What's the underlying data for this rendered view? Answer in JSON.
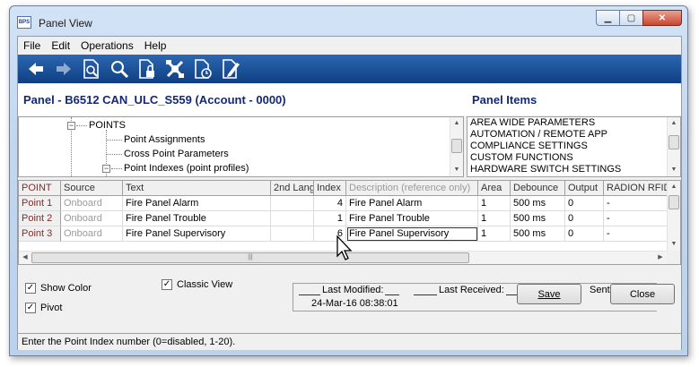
{
  "window": {
    "title": "Panel View",
    "icon_label": "BPS"
  },
  "menu": [
    "File",
    "Edit",
    "Operations",
    "Help"
  ],
  "toolbar": [
    "back-arrow-icon",
    "forward-arrow-icon",
    "print-preview-icon",
    "search-icon",
    "lock-document-icon",
    "network-icon",
    "document-clock-icon",
    "edit-document-icon"
  ],
  "header": {
    "panel_title": "Panel - B6512 CAN_ULC_S559 (Account - 0000)",
    "panel_items_title": "Panel Items"
  },
  "tree": {
    "points": "POINTS",
    "point_assignments": "Point Assignments",
    "cross_point_parameters": "Cross Point Parameters",
    "point_indexes": "Point Indexes (point profiles)"
  },
  "panel_items": [
    "AREA WIDE PARAMETERS",
    "AUTOMATION / REMOTE APP",
    "COMPLIANCE SETTINGS",
    "CUSTOM FUNCTIONS",
    "HARDWARE SWITCH SETTINGS"
  ],
  "grid": {
    "columns": [
      "POINT",
      "Source",
      "Text",
      "2nd Lang",
      "Index",
      "Description (reference only)",
      "Area",
      "Debounce",
      "Output",
      "RADION RFID"
    ],
    "rows": [
      {
        "point": "Point 1",
        "source": "Onboard",
        "text": "Fire Panel Alarm",
        "lang2": "",
        "index": "4",
        "description": "Fire Panel Alarm",
        "area": "1",
        "debounce": "500 ms",
        "output": "0",
        "radion": "-"
      },
      {
        "point": "Point 2",
        "source": "Onboard",
        "text": "Fire Panel Trouble",
        "lang2": "",
        "index": "1",
        "description": "Fire Panel Trouble",
        "area": "1",
        "debounce": "500 ms",
        "output": "0",
        "radion": "-"
      },
      {
        "point": "Point 3",
        "source": "Onboard",
        "text": "Fire Panel Supervisory",
        "lang2": "",
        "index": "6",
        "description": "Fire Panel Supervisory",
        "area": "1",
        "debounce": "500 ms",
        "output": "0",
        "radion": "-"
      }
    ]
  },
  "options": {
    "show_color": "Show Color",
    "pivot": "Pivot",
    "classic_view": "Classic View"
  },
  "info": {
    "last_modified_label": "Last Modified:",
    "last_modified_value": "24-Mar-16 08:38:01",
    "last_received_label": "Last Received:",
    "sent_label": "Sent:"
  },
  "buttons": {
    "save": "Save",
    "close": "Close"
  },
  "status": "Enter the Point Index number (0=disabled, 1-20)."
}
